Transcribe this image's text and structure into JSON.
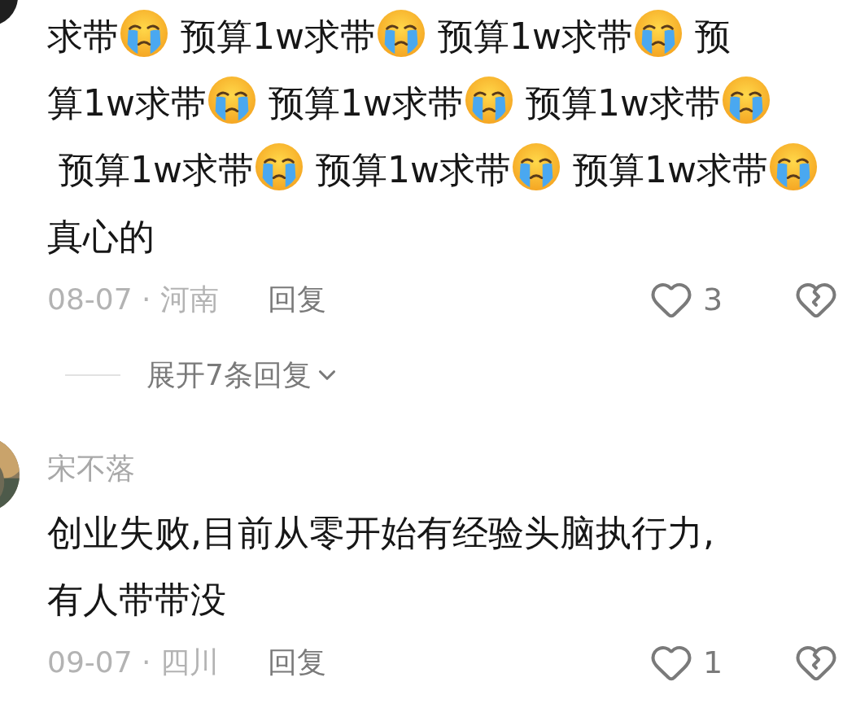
{
  "comments": [
    {
      "content": [
        {
          "kind": "text",
          "text": "求带"
        },
        {
          "kind": "emoji"
        },
        {
          "kind": "text",
          "text": " 预算1w求带"
        },
        {
          "kind": "emoji"
        },
        {
          "kind": "text",
          "text": " 预算1w求带"
        },
        {
          "kind": "emoji"
        },
        {
          "kind": "text",
          "text": " 预"
        },
        {
          "kind": "text",
          "text": "算1w求带"
        },
        {
          "kind": "emoji"
        },
        {
          "kind": "text",
          "text": " 预算1w求带"
        },
        {
          "kind": "emoji"
        },
        {
          "kind": "text",
          "text": " 预算1w求带"
        },
        {
          "kind": "emoji"
        },
        {
          "kind": "text",
          "text": " 预算1w求带"
        },
        {
          "kind": "emoji"
        },
        {
          "kind": "text",
          "text": " 预算1w求带"
        },
        {
          "kind": "emoji"
        },
        {
          "kind": "text",
          "text": " 预算1w"
        },
        {
          "kind": "text",
          "text": "求带"
        },
        {
          "kind": "emoji"
        },
        {
          "kind": "text",
          "text": "真心的"
        }
      ],
      "meta": "08-07 · 河南",
      "reply": "回复",
      "likes": "3",
      "expand_replies": "展开7条回复"
    },
    {
      "username": "宋不落",
      "content": [
        {
          "kind": "text",
          "text": "创业失败,目前从零开始有经验头脑执行力,有人带带没"
        }
      ],
      "meta": "09-07 · 四川",
      "reply": "回复",
      "likes": "1"
    }
  ]
}
